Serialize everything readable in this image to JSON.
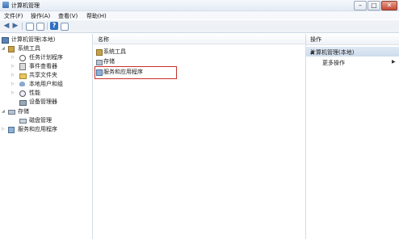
{
  "window": {
    "title": "计算机管理"
  },
  "menu": [
    "文件(F)",
    "操作(A)",
    "查看(V)",
    "帮助(H)"
  ],
  "tree": {
    "root": "计算机管理(本地)",
    "system_tools": "系统工具",
    "task_scheduler": "任务计划程序",
    "event_viewer": "事件查看器",
    "shared_folders": "共享文件夹",
    "local_users_groups": "本地用户和组",
    "performance": "性能",
    "device_manager": "设备管理器",
    "storage": "存储",
    "disk_management": "磁盘管理",
    "services_apps": "服务和应用程序"
  },
  "center": {
    "column_name": "名称",
    "items": [
      "系统工具",
      "存储",
      "服务和应用程序"
    ]
  },
  "actions": {
    "header": "操作",
    "section": "计算机管理(本地)",
    "more": "更多操作"
  },
  "colors": {
    "highlight": "#c8302b",
    "section_bg": "#d7e3f1"
  }
}
